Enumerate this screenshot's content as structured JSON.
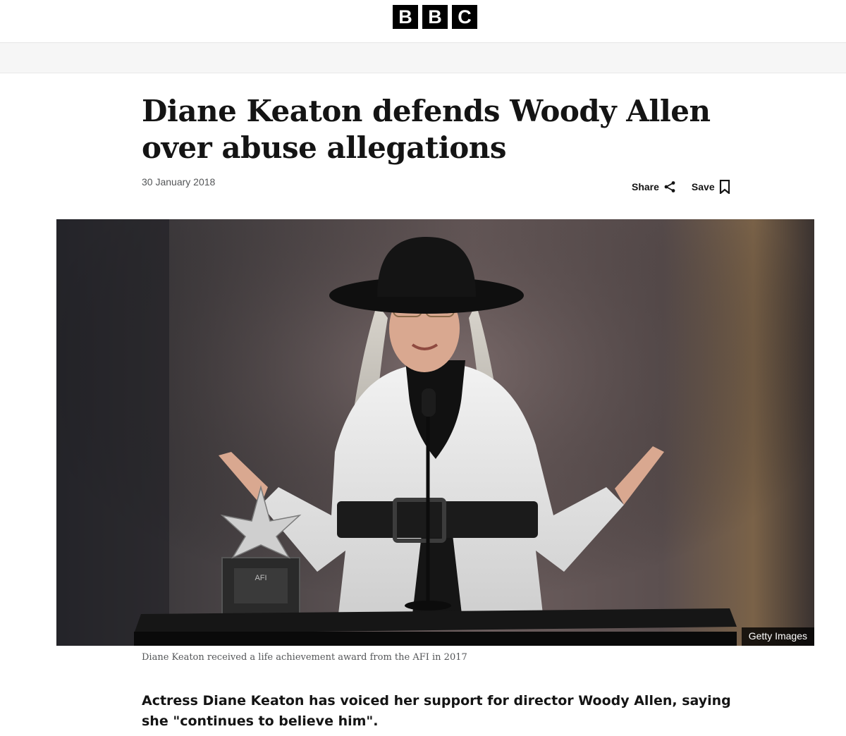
{
  "header": {
    "logo_letters": [
      "B",
      "B",
      "C"
    ]
  },
  "article": {
    "headline": "Diane Keaton defends Woody Allen over abuse allegations",
    "date": "30 January 2018",
    "share_label": "Share",
    "save_label": "Save",
    "image_credit": "Getty Images",
    "image_caption": "Diane Keaton received a life achievement award from the AFI in 2017",
    "lead_paragraph": "Actress Diane Keaton has voiced her support for director Woody Allen, saying she \"continues to believe him\".",
    "award_plaque_text": "AFI"
  },
  "colors": {
    "logo_block": "#000000",
    "nav_band": "#f6f6f6",
    "meta_text": "#545658",
    "body_text": "#141414"
  },
  "icons": {
    "share": "share-icon",
    "save": "bookmark-icon"
  }
}
